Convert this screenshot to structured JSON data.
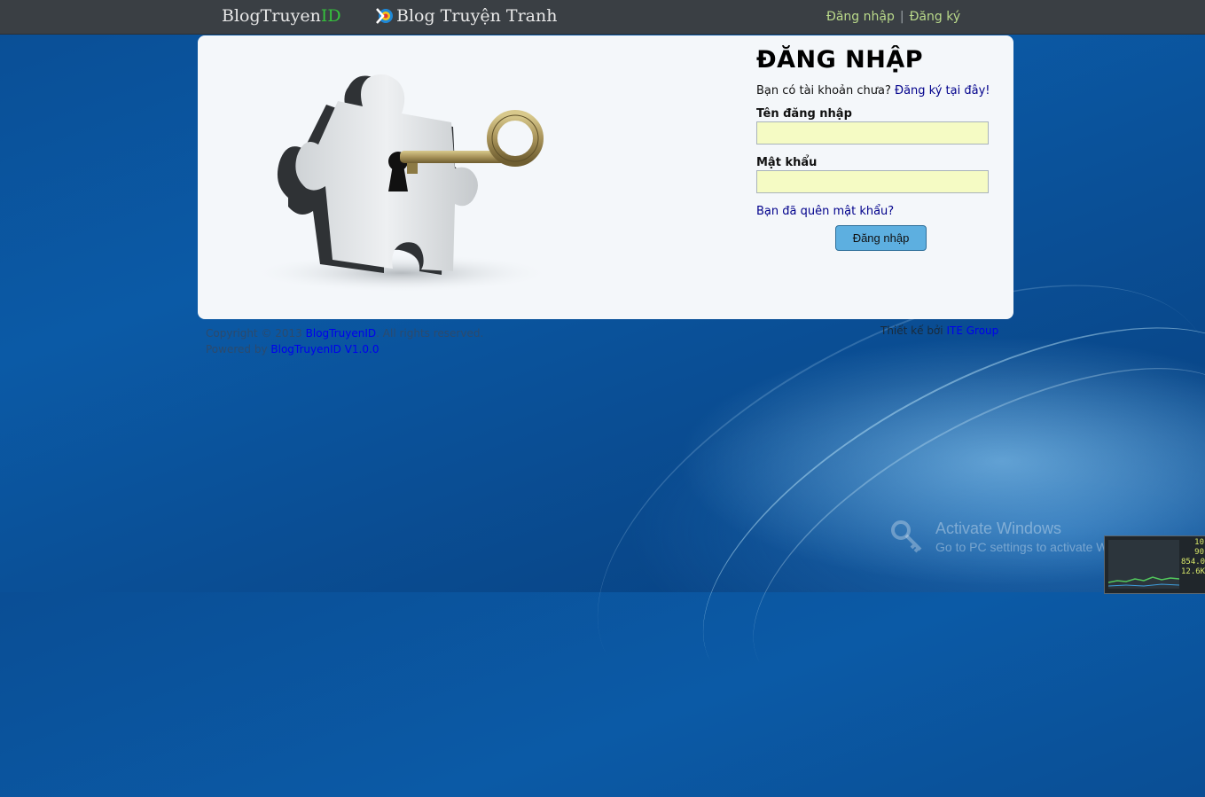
{
  "topbar": {
    "brand_main": "BlogTruyen",
    "brand_id": "ID",
    "brand_secondary": "Blog Truyện Tranh",
    "nav_login": "Đăng nhập",
    "nav_separator": "|",
    "nav_register": "Đăng ký"
  },
  "login": {
    "title": "ĐĂNG NHẬP",
    "question": "Bạn có tài khoản chưa?",
    "register_link": "Đăng ký tại đây!",
    "username_label": "Tên đăng nhập",
    "username_value": "",
    "password_label": "Mật khẩu",
    "password_value": "",
    "forgot_link": "Bạn đã quên mật khẩu?",
    "submit_label": "Đăng nhập"
  },
  "footer": {
    "copyright_prefix": "Copyright © 2013",
    "copyright_brand": "BlogTruyenID",
    "copyright_suffix": ". All rights reserved.",
    "powered_prefix": "Powered by",
    "powered_link": "BlogTruyenID V1.0.0",
    "designed_prefix": "Thiết kế bởi",
    "designed_link": "ITE Group"
  },
  "os_overlay": {
    "activate_title": "Activate Windows",
    "activate_subtitle": "Go to PC settings to activate Windows."
  },
  "system_widget": {
    "values": [
      "10",
      "90",
      "854.0",
      "12.6K"
    ]
  },
  "colors": {
    "brand_id_green": "#35c13c",
    "nav_link": "#b9d98a",
    "input_bg": "#f5fbc4",
    "button_bg": "#5dafe0",
    "link_dark": "#00008b"
  },
  "icons": [
    "puzzle-key-illustration",
    "blog-logo-icon",
    "activation-key-icon"
  ]
}
